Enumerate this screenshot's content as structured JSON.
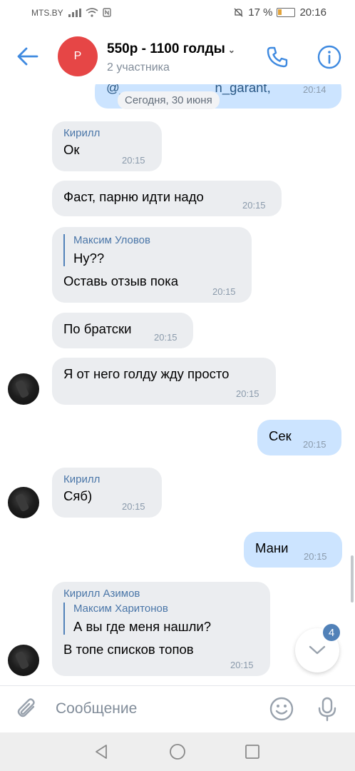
{
  "status": {
    "carrier": "MTS.BY",
    "battery": "17 %",
    "time": "20:16"
  },
  "header": {
    "avatar_letter": "Р",
    "title": "550р - 1100 голды",
    "subtitle": "2 участника"
  },
  "messages": {
    "top_partial_text": "@_____________n_garant,",
    "top_partial_time": "20:14",
    "date_divider": "Сегодня, 30 июня",
    "m1": {
      "author": "Кирилл",
      "text": "Ок",
      "time": "20:15"
    },
    "m2": {
      "text": "Фаст, парню идти надо",
      "time": "20:15"
    },
    "m3": {
      "reply_author": "Максим Уловов",
      "reply_text": "Ну??",
      "text": "Оставь отзыв пока",
      "time": "20:15"
    },
    "m4": {
      "text": "По братски",
      "time": "20:15"
    },
    "m5": {
      "text": "Я от него голду жду просто",
      "time": "20:15"
    },
    "m6": {
      "text": "Сек",
      "time": "20:15"
    },
    "m7": {
      "author": "Кирилл",
      "text": "Сяб)",
      "time": "20:15"
    },
    "m8": {
      "text": "Мани",
      "time": "20:15"
    },
    "m9": {
      "author": "Кирилл Азимов",
      "reply_author": "Максим Харитонов",
      "reply_text": "А вы где меня нашли?",
      "text": "В топе списков топов",
      "time": "20:15"
    }
  },
  "unread_count": "4",
  "composer": {
    "placeholder": "Сообщение"
  },
  "colors": {
    "accent": "#5181b8",
    "incoming_bubble": "#ebedf0",
    "outgoing_bubble": "#cce4ff",
    "group_avatar": "#e64646"
  }
}
